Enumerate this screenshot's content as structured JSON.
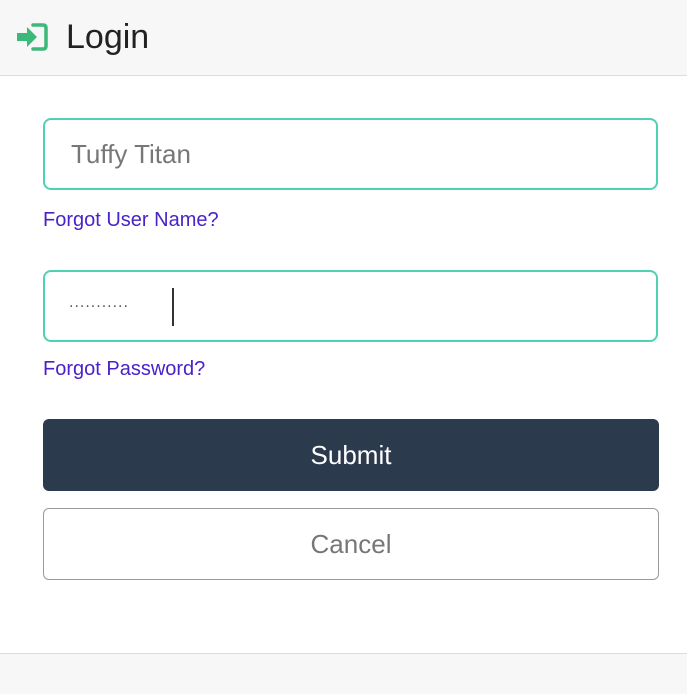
{
  "header": {
    "icon": "login-arrow-icon",
    "icon_color": "#3cb878",
    "title": "Login"
  },
  "form": {
    "username": {
      "value": "Tuffy Titan",
      "border_color": "#4fd1b3"
    },
    "forgot_username_label": "Forgot User Name?",
    "password": {
      "masked_value": "···········"
    },
    "forgot_password_label": "Forgot Password?",
    "submit_label": "Submit",
    "cancel_label": "Cancel"
  },
  "colors": {
    "submit_bg": "#2c3a4e",
    "link": "#4a22c9"
  }
}
